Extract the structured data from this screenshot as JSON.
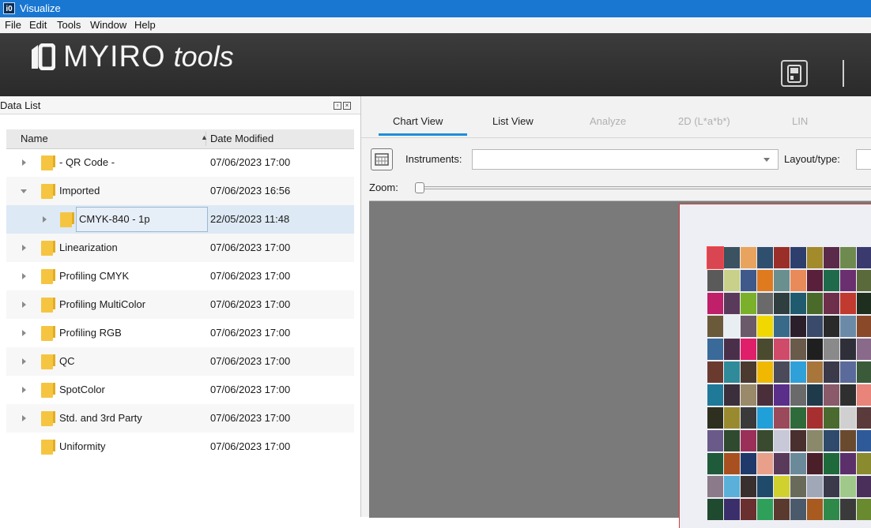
{
  "window": {
    "title": "Visualize",
    "app_icon_text": "i0"
  },
  "menu": [
    "File",
    "Edit",
    "Tools",
    "Window",
    "Help"
  ],
  "brand": {
    "name": "MYIRO",
    "suffix": "tools"
  },
  "data_list": {
    "title": "Data List",
    "columns": {
      "name": "Name",
      "date": "Date Modified",
      "sort": "ascending"
    },
    "rows": [
      {
        "name": "- QR Code -",
        "date": "07/06/2023 17:00",
        "expander": "collapsed",
        "level": 0
      },
      {
        "name": "Imported",
        "date": "07/06/2023 16:56",
        "expander": "expanded",
        "level": 0
      },
      {
        "name": "CMYK-840 - 1p",
        "date": "22/05/2023 11:48",
        "expander": "collapsed",
        "level": 1,
        "selected": true
      },
      {
        "name": "Linearization",
        "date": "07/06/2023 17:00",
        "expander": "collapsed",
        "level": 0
      },
      {
        "name": "Profiling CMYK",
        "date": "07/06/2023 17:00",
        "expander": "collapsed",
        "level": 0
      },
      {
        "name": "Profiling MultiColor",
        "date": "07/06/2023 17:00",
        "expander": "collapsed",
        "level": 0
      },
      {
        "name": "Profiling RGB",
        "date": "07/06/2023 17:00",
        "expander": "collapsed",
        "level": 0
      },
      {
        "name": "QC",
        "date": "07/06/2023 17:00",
        "expander": "collapsed",
        "level": 0
      },
      {
        "name": "SpotColor",
        "date": "07/06/2023 17:00",
        "expander": "collapsed",
        "level": 0
      },
      {
        "name": "Std. and 3rd Party",
        "date": "07/06/2023 17:00",
        "expander": "collapsed",
        "level": 0
      },
      {
        "name": "Uniformity",
        "date": "07/06/2023 17:00",
        "expander": "none",
        "level": 0
      }
    ]
  },
  "tabs": [
    {
      "label": "Chart View",
      "active": true,
      "enabled": true
    },
    {
      "label": "List View",
      "active": false,
      "enabled": true
    },
    {
      "label": "Analyze",
      "active": false,
      "enabled": false
    },
    {
      "label": "2D (L*a*b*)",
      "active": false,
      "enabled": false
    },
    {
      "label": "LIN",
      "active": false,
      "enabled": false
    }
  ],
  "toolbar": {
    "instruments_label": "Instruments:",
    "instruments_value": "",
    "layout_label": "Layout/type:",
    "zoom_label": "Zoom:",
    "zoom_value": 0
  },
  "colors": {
    "titlebar": "#1977d2",
    "tab_accent": "#1c8fd9",
    "folder": "#f5c542",
    "selection": "#dde9f4"
  },
  "chart_patches": [
    [
      "#d94550",
      "#3b5260",
      "#e8a45e",
      "#2f4f6e",
      "#9a2f2a",
      "#2e3f6e",
      "#a38a2a",
      "#5b2a4a",
      "#6e8a4e",
      "#3a3a6e"
    ],
    [
      "#5a5a5a",
      "#c8d08a",
      "#3f5a8a",
      "#e07a1f",
      "#6a8f8f",
      "#e88a5a",
      "#5a1f3a",
      "#1f6a4a",
      "#6a2f6e",
      "#5a6a3a"
    ],
    [
      "#c01f6a",
      "#5a3a5a",
      "#7ab02a",
      "#6a6a6a",
      "#2f3f3f",
      "#1f5a6e",
      "#4a6a2a",
      "#6e2f4a",
      "#c03a2f",
      "#1f2f1f"
    ],
    [
      "#6a5a3a",
      "#e8eef2",
      "#6a5a6a",
      "#f0d800",
      "#3a6a8a",
      "#2a1f2a",
      "#3a4a6a",
      "#2a2a2a",
      "#6a8aa8",
      "#8a4a2a"
    ],
    [
      "#3a6a9a",
      "#4a2f4a",
      "#e01f6a",
      "#4a4a2f",
      "#d04a6a",
      "#6a5a4a",
      "#1f1f1f",
      "#8a8a8a",
      "#2f2f3a",
      "#8a6a8a"
    ],
    [
      "#6a3a2f",
      "#2f8a9a",
      "#4a3a2f",
      "#f0b800",
      "#4a4a5a",
      "#2fa0d8",
      "#a8753a",
      "#3a3a4a",
      "#5a6a9a",
      "#3a5a3a"
    ],
    [
      "#1f7a9a",
      "#3a2f3a",
      "#9a8a6a",
      "#4a2f3a",
      "#5a2f8a",
      "#6a6a6a",
      "#1f3a4a",
      "#8a5a6a",
      "#2f2f2f",
      "#e8847a"
    ],
    [
      "#2f2f1f",
      "#9a8a2f",
      "#3a3a3a",
      "#1fa0d8",
      "#9a4a5a",
      "#2f6a3a",
      "#a82f2f",
      "#4a6a2f",
      "#d0d0d0",
      "#5a3a3a"
    ],
    [
      "#6a5a8a",
      "#2f4a2f",
      "#9a2f5a",
      "#3a4a2f",
      "#c8c8d8",
      "#4a2f2f",
      "#8a8a6a",
      "#2f4a6a",
      "#6a4a2f",
      "#2f5a9a"
    ],
    [
      "#1f5a3a",
      "#a8501f",
      "#1f3a6a",
      "#e8a08a",
      "#5a3a5a",
      "#6a8a9a",
      "#4a1f2a",
      "#1f6a3a",
      "#5a2f6a",
      "#8a8a2f"
    ],
    [
      "#8a7a8a",
      "#5ab0d8",
      "#3a2f2f",
      "#1f4a6a",
      "#d0d02f",
      "#6a6a5a",
      "#a0a8b8",
      "#3a3a4a",
      "#a0c88a",
      "#4a2f5a"
    ],
    [
      "#1f4a2f",
      "#3a2f6a",
      "#6a2f2f",
      "#2fa05a",
      "#5a3a2f",
      "#4a5a6a",
      "#a85a1f",
      "#2f8a4a",
      "#3a3a3a",
      "#6a8a2f"
    ]
  ]
}
